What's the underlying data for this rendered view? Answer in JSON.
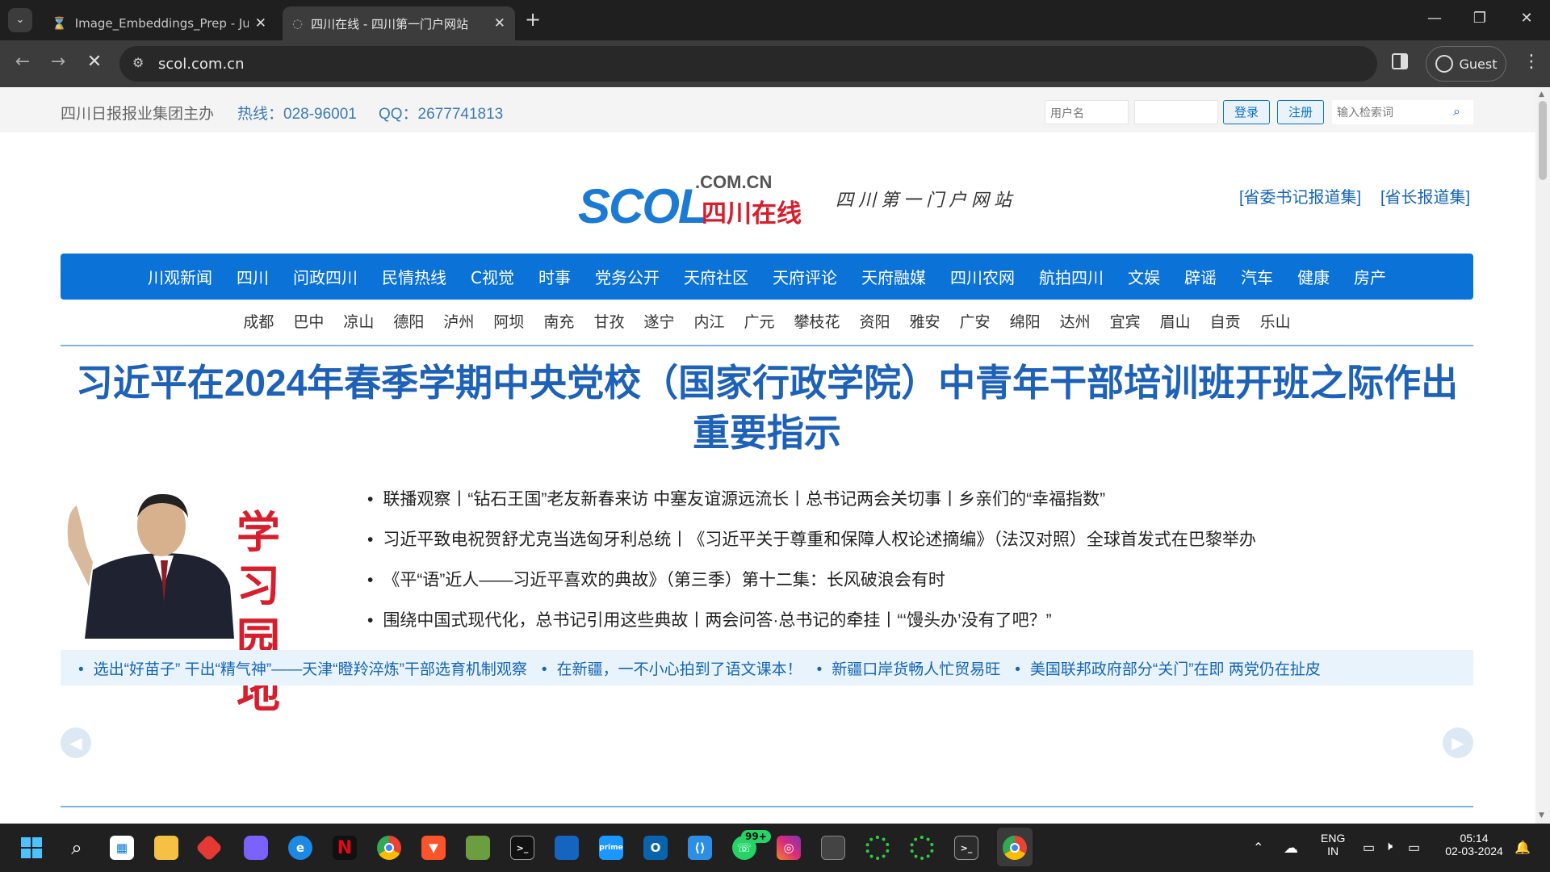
{
  "browser": {
    "tabs": [
      {
        "title": "Image_Embeddings_Prep - Jupy",
        "icon": "hourglass-icon"
      },
      {
        "title": "四川在线 - 四川第一门户网站",
        "icon": "loading-icon"
      }
    ],
    "address": "scol.com.cn",
    "profile_label": "Guest"
  },
  "page": {
    "topbar": {
      "sponsor": "四川日报报业集团主办",
      "hotline": "热线：028-96001",
      "qq": "QQ：2677741813",
      "username_placeholder": "用户名",
      "login_label": "登录",
      "register_label": "注册",
      "search_placeholder": "输入检索词"
    },
    "logo": {
      "main": "SCOL",
      "domain": ".COM.CN",
      "cn": "四川在线"
    },
    "slogan": "四川第一门户网站",
    "header_links": [
      "[省委书记报道集]",
      "[省长报道集]"
    ],
    "main_nav": [
      "川观新闻",
      "四川",
      "问政四川",
      "民情热线",
      "C视觉",
      "时事",
      "党务公开",
      "天府社区",
      "天府评论",
      "天府融媒",
      "四川农网",
      "航拍四川",
      "文娱",
      "辟谣",
      "汽车",
      "健康",
      "房产"
    ],
    "city_nav": [
      "成都",
      "巴中",
      "凉山",
      "德阳",
      "泸州",
      "阿坝",
      "南充",
      "甘孜",
      "遂宁",
      "内江",
      "广元",
      "攀枝花",
      "资阳",
      "雅安",
      "广安",
      "绵阳",
      "达州",
      "宜宾",
      "眉山",
      "自贡",
      "乐山"
    ],
    "headline": "习近平在2024年春季学期中央党校（国家行政学院）中青年干部培训班开班之际作出重要指示",
    "promo_text": "学习园地",
    "bullets": [
      "联播观察丨“钻石王国”老友新春来访 中塞友谊源远流长丨总书记两会关切事丨乡亲们的“幸福指数”",
      "习近平致电祝贺舒尤克当选匈牙利总统丨《习近平关于尊重和保障人权论述摘编》（法汉对照）全球首发式在巴黎举办",
      "《平“语”近人——习近平喜欢的典故》（第三季）第十二集：长风破浪会有时",
      "围绕中国式现代化，总书记引用这些典故丨两会问答·总书记的牵挂丨“‘馒头办’没有了吧？”"
    ],
    "ticker": [
      "选出“好苗子” 干出“精气神”——天津“瞪羚淬炼”干部选育机制观察",
      "在新疆，一不小心拍到了语文课本！",
      "新疆口岸货畅人忙贸易旺",
      "美国联邦政府部分“关门”在即 两党仍在扯皮"
    ]
  },
  "taskbar": {
    "apps": [
      "start-icon",
      "search-icon",
      "store-icon",
      "file-explorer-icon",
      "app-red-icon",
      "copilot-icon",
      "edge-icon",
      "netflix-icon",
      "chrome-icon",
      "brave-icon",
      "minecraft-icon",
      "terminal-icon",
      "app-blue-icon",
      "prime-video-icon",
      "outlook-icon",
      "vscode-icon",
      "whatsapp-icon",
      "instagram-icon",
      "app-grey-icon",
      "loading-green-icon",
      "loading-green-icon-2",
      "terminal-2-icon",
      "chrome-active-icon"
    ],
    "whatsapp_badge": "99+",
    "lang_top": "ENG",
    "lang_bottom": "IN",
    "time": "05:14",
    "date": "02-03-2024"
  }
}
